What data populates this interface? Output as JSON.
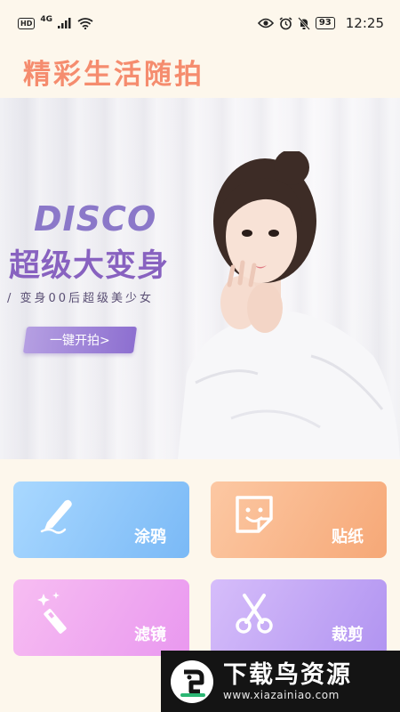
{
  "status_bar": {
    "hd": "HD",
    "network": "4G",
    "battery": "93",
    "time": "12:25"
  },
  "app": {
    "title": "精彩生活随拍"
  },
  "banner": {
    "brand": "DISCO",
    "headline": "超级大变身",
    "subline": "/ 变身00后超级美少女",
    "cta_label": "一键开拍>"
  },
  "features": [
    {
      "label": "涂鸦",
      "icon": "pen-icon"
    },
    {
      "label": "贴纸",
      "icon": "sticker-icon"
    },
    {
      "label": "滤镜",
      "icon": "magic-wand-icon"
    },
    {
      "label": "裁剪",
      "icon": "scissors-icon"
    }
  ],
  "watermark": {
    "title": "下载鸟资源",
    "url": "www.xiazainiao.com"
  },
  "colors": {
    "title": "#f58c6e",
    "background": "#fdf7ec",
    "banner_accent": "#8862c0"
  }
}
